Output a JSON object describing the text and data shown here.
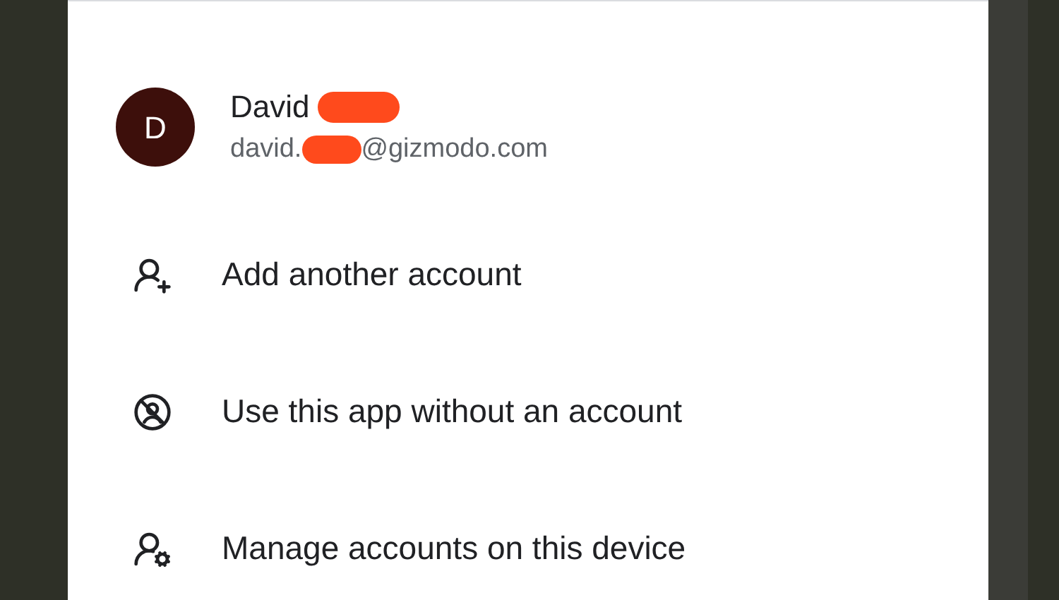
{
  "account": {
    "initial": "D",
    "name": "David",
    "email_start": "david.",
    "email_end": "@gizmodo.com",
    "redacted": true
  },
  "items": [
    {
      "kind": "add",
      "label": "Add another account"
    },
    {
      "kind": "no-account",
      "label": "Use this app without an account"
    },
    {
      "kind": "manage",
      "label": "Manage accounts on this device"
    }
  ]
}
